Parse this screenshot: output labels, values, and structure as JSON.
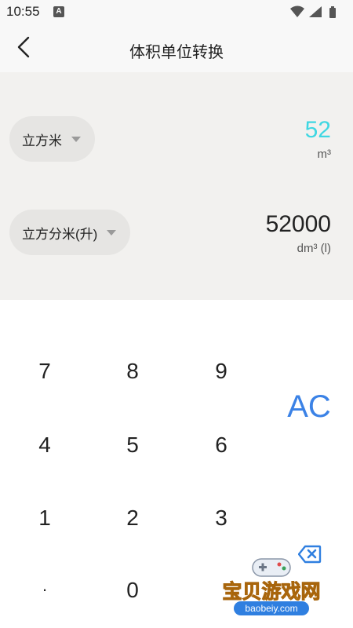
{
  "status_bar": {
    "time": "10:55",
    "notification_badge": "A"
  },
  "header": {
    "title": "体积单位转换"
  },
  "converter": {
    "from": {
      "unit_name": "立方米",
      "value": "52",
      "symbol": "m³"
    },
    "to": {
      "unit_name": "立方分米(升)",
      "value": "52000",
      "symbol": "dm³ (l)"
    }
  },
  "keypad": {
    "keys": [
      "7",
      "8",
      "9",
      "4",
      "5",
      "6",
      "1",
      "2",
      "3",
      ".",
      "0"
    ],
    "clear_label": "AC"
  },
  "watermark": {
    "text": "宝贝游戏网",
    "url": "baobeiy.com"
  },
  "colors": {
    "from_value": "#3fd7e2",
    "accent": "#3b82e6",
    "panel_bg": "#f2f1ef"
  },
  "icons": [
    "back-arrow-icon",
    "wifi-icon",
    "signal-icon",
    "battery-icon",
    "caret-down-icon",
    "backspace-icon",
    "gamepad-icon"
  ]
}
